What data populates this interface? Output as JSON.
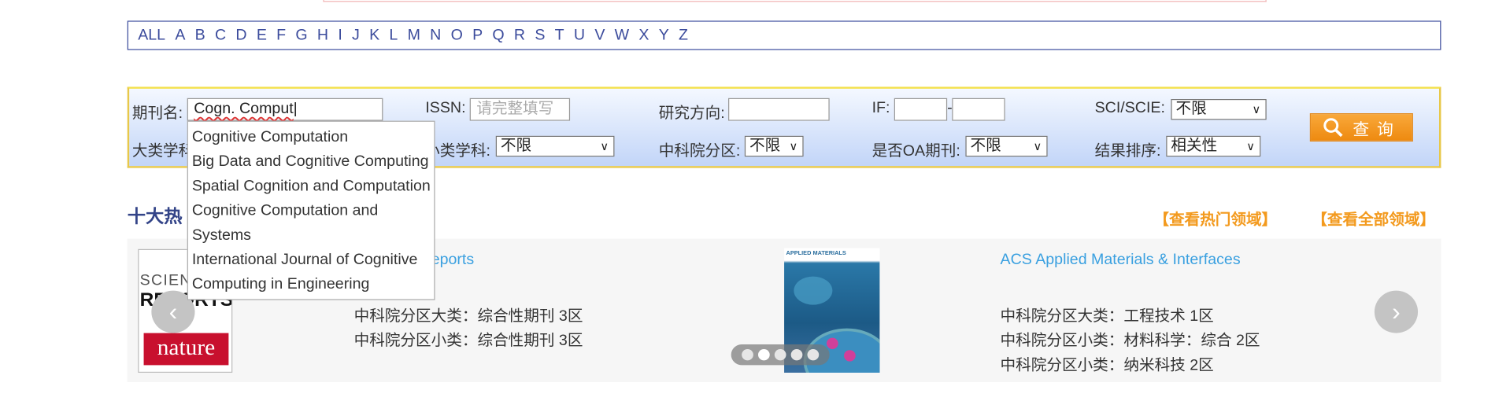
{
  "alphabet": [
    "ALL",
    "A",
    "B",
    "C",
    "D",
    "E",
    "F",
    "G",
    "H",
    "I",
    "J",
    "K",
    "L",
    "M",
    "N",
    "O",
    "P",
    "Q",
    "R",
    "S",
    "T",
    "U",
    "V",
    "W",
    "X",
    "Y",
    "Z"
  ],
  "search": {
    "journal_label": "期刊名:",
    "journal_value": "Cogn. Comput",
    "issn_label": "ISSN:",
    "issn_placeholder": "请完整填写",
    "direction_label": "研究方向:",
    "if_label": "IF:",
    "if_dash": "-",
    "sci_label": "SCI/SCIE:",
    "sci_value": "不限",
    "major_label": "大类学科",
    "minor_label": "小类学科:",
    "minor_value": "不限",
    "cas_label": "中科院分区:",
    "cas_value": "不限",
    "oa_label": "是否OA期刊:",
    "oa_value": "不限",
    "sort_label": "结果排序:",
    "sort_value": "相关性",
    "button_label": "查询"
  },
  "suggestions": [
    "Cognitive Computation",
    "Big Data and Cognitive Computing",
    "Spatial Cognition and Computation",
    "Cognitive Computation and",
    "Systems",
    "International Journal of Cognitive",
    "Computing in Engineering"
  ],
  "hot": {
    "title": "十大热",
    "link_hot": "【查看热门领域】",
    "link_all": "【查看全部领域】"
  },
  "carousel": {
    "items": [
      {
        "title": "Scientific Reports",
        "lines": [
          "中科院分区大类：综合性期刊 3区",
          "中科院分区小类：综合性期刊 3区"
        ],
        "cover": {
          "top": "SCIENTIFIC",
          "mid": "REPORTS",
          "brand": "nature"
        }
      },
      {
        "title": "ACS Applied Materials & Interfaces",
        "lines": [
          "中科院分区大类：工程技术 1区",
          "中科院分区小类：材料科学：综合 2区",
          "中科院分区小类：纳米科技 2区"
        ],
        "cover": {
          "top": "APPLIED MATERIALS & INTERFACES"
        }
      }
    ],
    "dots": 5,
    "active_dot": 1,
    "prev_icon": "chevron-left-icon",
    "next_icon": "chevron-right-icon"
  },
  "colors": {
    "accent": "#3b4b9c",
    "link": "#3aa0e0",
    "orange": "#f39a1e"
  }
}
